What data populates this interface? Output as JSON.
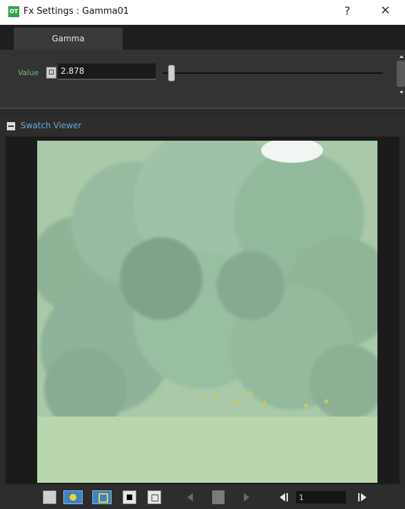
{
  "window": {
    "title": "Fx Settings : Gamma01",
    "help": "?",
    "close": "×",
    "app_icon_text": "OT"
  },
  "tabs": [
    {
      "label": "Gamma",
      "active": true
    }
  ],
  "parameter": {
    "label": "Value",
    "value": "2.878",
    "slider_fraction": 0.03
  },
  "swatch": {
    "title": "Swatch Viewer"
  },
  "toolbar": {
    "frame_value": "1"
  },
  "colors": {
    "accent_green": "#6fbf7a",
    "accent_blue": "#6fa8d8",
    "toggle_active": "#3b84c4",
    "toggle_icon": "#f1d33a"
  }
}
